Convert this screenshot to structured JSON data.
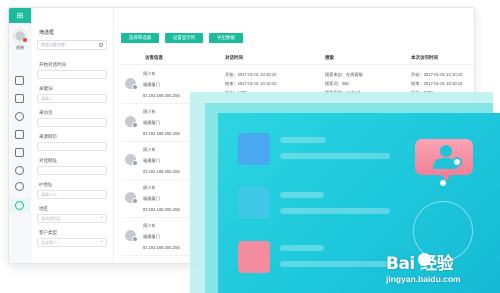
{
  "rail": {
    "logo": "⊞",
    "user_name": "周晓",
    "icons": [
      "home-icon",
      "file-icon",
      "clock-icon",
      "copy-icon",
      "mail-icon",
      "chat-icon",
      "user-icon",
      "grid-icon",
      "settings-icon"
    ]
  },
  "filter": {
    "title": "筛选框",
    "search_placeholder": "搜索访客名称",
    "fields": [
      {
        "label": "开始对话时间",
        "value": ""
      },
      {
        "label": "关键词",
        "value": "请输入"
      },
      {
        "label": "来访页",
        "value": ""
      },
      {
        "label": "来源网页",
        "value": ""
      },
      {
        "label": "对话网址",
        "value": ""
      },
      {
        "label": "IP地址",
        "value": "请输入IP"
      },
      {
        "label": "地区",
        "value": "请选择地区"
      },
      {
        "label": "客户类型",
        "value": "全部客户"
      }
    ]
  },
  "toolbar": {
    "buttons": [
      "选择筛选器",
      "设置显示列",
      "导出数据"
    ]
  },
  "table": {
    "headers": [
      "访客信息",
      "对话时间",
      "搜索",
      "本次访问时间"
    ],
    "rows": [
      {
        "name": "周少东",
        "location": "福建厦门",
        "ip": "ID:192.168.255.255",
        "time": [
          "开始：2017-01-01 10:10:10",
          "结束：2017-01-01 10:10:10",
          "时长：1'25''"
        ],
        "search": [
          "搜索来自：在线客服",
          "搜索词：360",
          "操作系统：Android"
        ],
        "visit": [
          "开始：2017-01-01 10:10:10",
          "结束：2017-01-01 10:10:10",
          "时长：1'25''"
        ]
      },
      {
        "name": "周少东",
        "location": "福建厦门",
        "ip": "ID:192.168.255.255",
        "time": [
          "开始：2017-01-01 10:10:10",
          "结束：2017-01-01 10:10:10",
          "时长：1'25''"
        ],
        "search": [
          "搜索来自：在线客服",
          "搜索词：360",
          "操作系统：Android"
        ],
        "visit": [
          "开始：2017-01-01 10:10:10",
          "结束：2017-01-01 10:10:10",
          "时长：1'25''"
        ]
      },
      {
        "name": "周少东",
        "location": "福建厦门",
        "ip": "ID:192.168.255.255",
        "time": [
          "开始：2017-01-01 10:10:10",
          "",
          ""
        ],
        "search": [
          "",
          "",
          ""
        ],
        "visit": [
          "",
          "",
          ""
        ]
      },
      {
        "name": "周少东",
        "location": "福建厦门",
        "ip": "ID:192.168.255.255",
        "time": [
          "开始：2017-01-01 10:10:10",
          "",
          ""
        ],
        "search": [
          "",
          "",
          ""
        ],
        "visit": [
          "",
          "",
          ""
        ]
      },
      {
        "name": "周少东",
        "location": "福建厦门",
        "ip": "ID:192.168.255.255",
        "time": [
          "开始：2017-01-01 10:10:10",
          "",
          ""
        ],
        "search": [
          "",
          "",
          ""
        ],
        "visit": [
          "",
          "",
          ""
        ]
      }
    ]
  },
  "overlay": {
    "square_colors": [
      "#4aa8f0",
      "#3fc7e8",
      "#f48ca0"
    ],
    "bubble_color": "#f48ca0"
  },
  "watermark": {
    "brand": "Bai  经验",
    "url": "jingyan.baidu.com"
  }
}
